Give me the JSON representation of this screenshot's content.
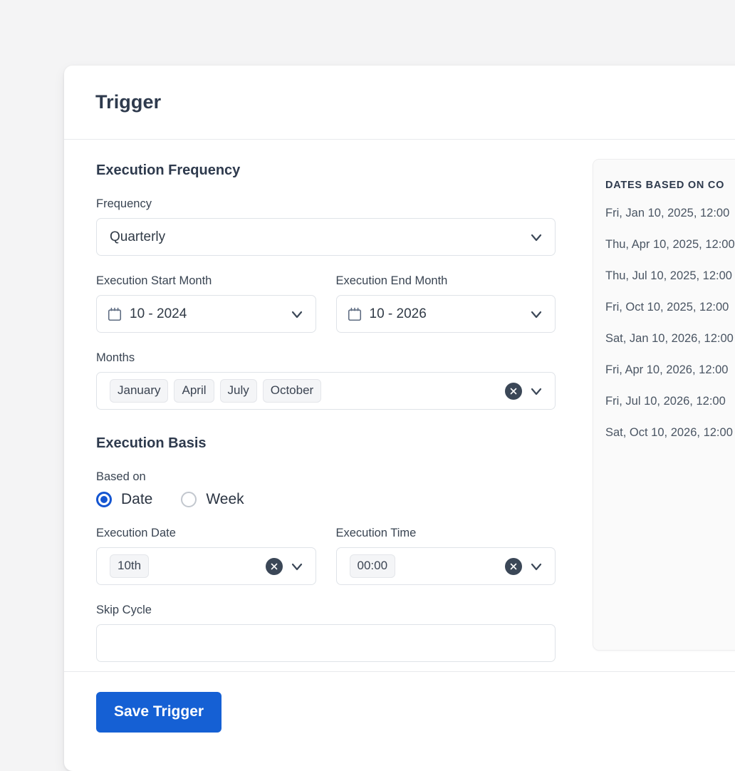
{
  "header": {
    "title": "Trigger"
  },
  "frequency_section": {
    "title": "Execution Frequency",
    "frequency": {
      "label": "Frequency",
      "value": "Quarterly"
    },
    "start_month": {
      "label": "Execution Start Month",
      "value": "10 - 2024",
      "icon": "calendar-icon"
    },
    "end_month": {
      "label": "Execution End Month",
      "value": "10 - 2026",
      "icon": "calendar-icon"
    },
    "months": {
      "label": "Months",
      "chips": [
        "January",
        "April",
        "July",
        "October"
      ]
    }
  },
  "basis_section": {
    "title": "Execution Basis",
    "based_on": {
      "label": "Based on",
      "options": [
        {
          "label": "Date",
          "selected": true
        },
        {
          "label": "Week",
          "selected": false
        }
      ]
    },
    "execution_date": {
      "label": "Execution Date",
      "chips": [
        "10th"
      ]
    },
    "execution_time": {
      "label": "Execution Time",
      "chips": [
        "00:00"
      ]
    },
    "skip_cycle": {
      "label": "Skip Cycle",
      "value": ""
    }
  },
  "preview_panel": {
    "heading": "DATES BASED ON CO",
    "dates": [
      "Fri, Jan 10, 2025, 12:00 ",
      "Thu, Apr 10, 2025, 12:00",
      "Thu, Jul 10, 2025, 12:00",
      "Fri, Oct 10, 2025, 12:00 ",
      "Sat, Jan 10, 2026, 12:00",
      "Fri, Apr 10, 2026, 12:00 ",
      "Fri, Jul 10, 2026, 12:00 ",
      "Sat, Oct 10, 2026, 12:00"
    ]
  },
  "footer": {
    "save_label": "Save Trigger"
  },
  "colors": {
    "accent": "#1560d4",
    "radio_selected": "#1455d1",
    "clear_button": "#3b4757",
    "page_background": "#f4f4f5",
    "heading_text": "#2e3a4d"
  }
}
